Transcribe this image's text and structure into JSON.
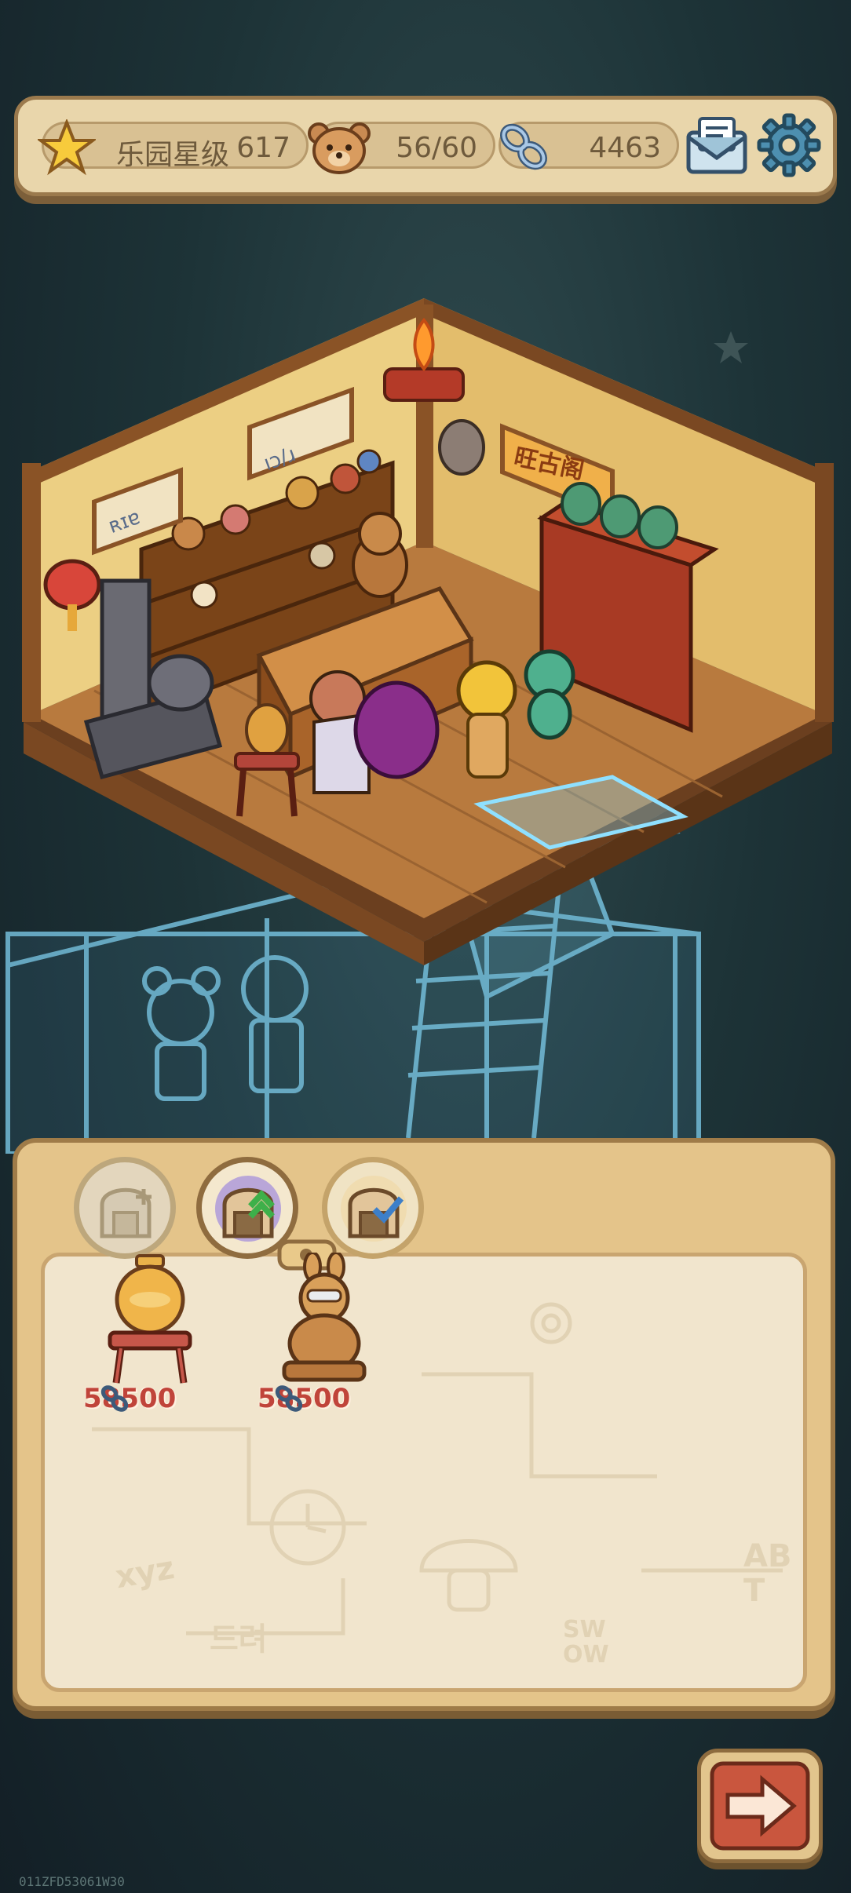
{
  "top_bar": {
    "rating_label": "乐园星级",
    "rating_value": "617",
    "bears_value": "56/60",
    "links_value": "4463",
    "icons": [
      "star-icon",
      "bear-icon",
      "chain-link-icon",
      "mail-icon",
      "gear-icon"
    ]
  },
  "scene": {
    "sign_right": "旺古阁",
    "sign_left": "ʀɪɐ",
    "sign_middle": "ıɔ/ɹ"
  },
  "panel": {
    "tabs": [
      {
        "icon": "furnace-plus-icon",
        "state": "disabled"
      },
      {
        "icon": "furnace-upgrade-icon",
        "state": "selected"
      },
      {
        "icon": "furnace-check-icon",
        "state": "normal"
      }
    ],
    "items": [
      {
        "icon": "vase-on-stand-icon",
        "price": "58500"
      },
      {
        "icon": "rabbit-statue-icon",
        "price": "58500"
      }
    ],
    "doodles": [
      "xyz",
      "SW OW",
      "AB T",
      "드려"
    ]
  },
  "next_button": {
    "icon": "arrow-right-icon"
  },
  "build_id": "011ZFD53061W30",
  "colors": {
    "panel": "#e4c48a",
    "panel_border": "#9f7b48",
    "price_text": "#c0443a",
    "blueprint": "#7fd0f0"
  }
}
